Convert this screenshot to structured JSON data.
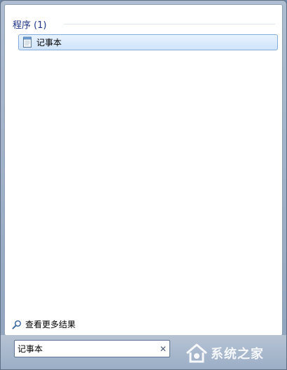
{
  "results": {
    "group_header": "程序 (1)",
    "items": [
      {
        "label": "记事本",
        "icon": "notepad-icon"
      }
    ]
  },
  "see_more": {
    "label": "查看更多结果",
    "icon": "search-icon"
  },
  "search": {
    "value": "记事本",
    "clear_icon": "✕"
  },
  "watermark": {
    "text": "系统之家",
    "icon": "house-logo-icon"
  },
  "colors": {
    "group_header": "#1e3287",
    "highlight_border": "#84acdd",
    "frame": "#8fa3bd"
  }
}
